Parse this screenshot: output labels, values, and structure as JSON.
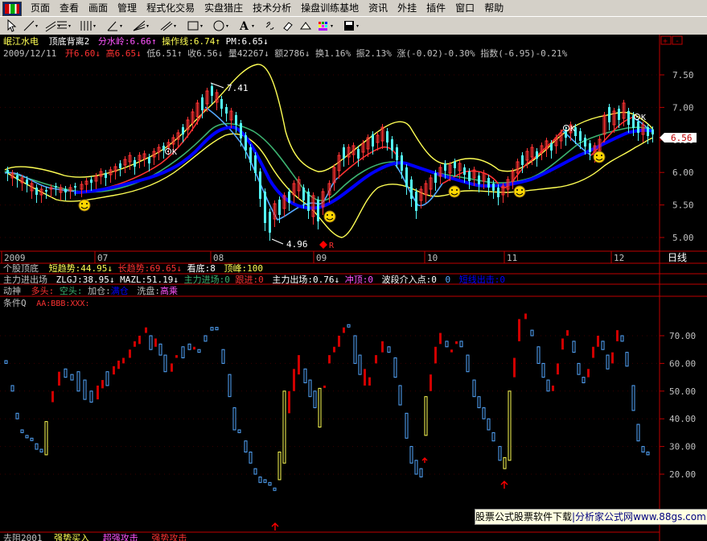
{
  "menu": [
    "页面",
    "查看",
    "画面",
    "管理",
    "程式化交易",
    "实盘猎庄",
    "技术分析",
    "操盘训练基地",
    "资讯",
    "外挂",
    "插件",
    "窗口",
    "帮助"
  ],
  "toolbar_icons": [
    "pointer-icon",
    "line-icon",
    "channel-icon",
    "fib-icon",
    "bars-icon",
    "angle-icon",
    "fan-icon",
    "rect-icon",
    "ellipse-icon",
    "text-icon",
    "link-icon",
    "eraser-icon",
    "color-icon",
    "save-icon"
  ],
  "main_panel": {
    "title": {
      "stock": "岷江水电",
      "indicator": "顶底背离2",
      "fsl_label": "分水岭:",
      "fsl_value": "6.66",
      "fsl_arrow": "↑",
      "czx_label": "操作线:",
      "czx_value": "6.74",
      "czx_arrow": "↑",
      "pm_label": "PM:",
      "pm_value": "6.65",
      "pm_arrow": "↓"
    },
    "quote": {
      "date": "2009/12/11",
      "open_label": "开",
      "open": "6.60",
      "open_arrow": "↓",
      "high_label": "高",
      "high": "6.65",
      "high_arrow": "↓",
      "low_label": "低",
      "low": "6.51",
      "low_arrow": "↑",
      "close_label": "收",
      "close": "6.56",
      "close_arrow": "↓",
      "vol_label": "量",
      "vol": "42267",
      "vol_arrow": "↓",
      "amt_label": "额",
      "amt": "2786",
      "amt_arrow": "↓",
      "turn_label": "换",
      "turn": "1.16%",
      "amp_label": "振",
      "amp": "2.13%",
      "chg_label": "涨",
      "chg": "(-0.02)-0.30%",
      "idx_label": "指数",
      "idx": "(-6.95)-0.21%"
    },
    "y_ticks": [
      "7.50",
      "7.00",
      "6.50",
      "6.00",
      "5.50",
      "5.00"
    ],
    "y_values": [
      7.5,
      7.0,
      6.5,
      6.0,
      5.5,
      5.0
    ],
    "price_label": "6.56",
    "annotations": {
      "high": "7.41",
      "low": "4.96",
      "r_marker": "R",
      "k_marker": "K"
    },
    "x_labels": [
      "2009",
      "07",
      "08",
      "09",
      "10",
      "11",
      "12"
    ],
    "period": "日线"
  },
  "panel2": {
    "name": "个股顶底",
    "short_label": "短趋势:",
    "short_value": "44.95",
    "short_arrow": "↓",
    "long_label": "长趋势:",
    "long_value": "69.65",
    "long_arrow": "↓",
    "kd_label": "看底:",
    "kd_value": "8",
    "df_label": "顶峰:",
    "df_value": "100"
  },
  "panel3": {
    "name": "主力进出场",
    "zlgj": "ZLGJ:38.95",
    "zlgj_arrow": "↓",
    "mazl": "MAZL:51.19",
    "mazl_arrow": "↓",
    "enter": "主力进场:0",
    "chase": "跟进:0",
    "exit": "主力出场:0.76",
    "exit_arrow": "↓",
    "rush": "冲顶:0",
    "wave": "波段介入点:0",
    "zero": "0",
    "escape": "短线出击:0"
  },
  "panel4": {
    "name": "动神",
    "bull": "多头:",
    "bear": "空头:",
    "add": "加仓:",
    "add_v": "满仓",
    "wash": "洗盘:",
    "wash_v": "高乘"
  },
  "panel5": {
    "name": "条件Q",
    "formula": "AA:BBB:XXX:"
  },
  "osc": {
    "y_ticks": [
      "70.00",
      "60.00",
      "50.00",
      "40.00",
      "30.00",
      "20.00"
    ],
    "y_values": [
      70,
      60,
      50,
      40,
      30,
      20
    ]
  },
  "bottom_partial": {
    "a": "去阻2001",
    "b": "强势买入",
    "c": "超强攻击",
    "d": "强势攻击"
  },
  "ad": {
    "part1": "股票公式股票软件下载",
    "part2": "|分析家公式网",
    "part3": "www.88gs.com|"
  },
  "colors": {
    "up": "#ff3232",
    "down": "#54fcfc",
    "blue": "#0000ff",
    "yellow": "#ffff54",
    "green": "#3cb371",
    "axis": "#c00000",
    "text_yellow": "#ffff54",
    "text_magenta": "#ff54ff"
  }
}
